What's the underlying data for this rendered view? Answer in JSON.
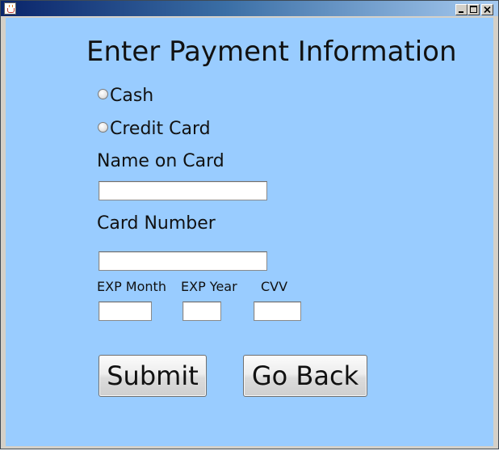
{
  "window": {
    "icon": "java-cup-icon",
    "controls": [
      "minimize",
      "maximize",
      "close"
    ]
  },
  "form": {
    "heading": "Enter Payment Information",
    "payment_options": [
      {
        "label": "Cash",
        "checked": false
      },
      {
        "label": "Credit Card",
        "checked": false
      }
    ],
    "name_label": "Name on Card",
    "name_value": "",
    "card_label": "Card Number",
    "card_value": "",
    "exp_month_label": "EXP Month",
    "exp_month_value": "",
    "exp_year_label": "EXP Year",
    "exp_year_value": "",
    "cvv_label": "CVV",
    "cvv_value": "",
    "submit_label": "Submit",
    "back_label": "Go Back"
  },
  "colors": {
    "panel_background": "#99ccff",
    "titlebar_start": "#0a246a",
    "titlebar_end": "#a6caf0"
  }
}
